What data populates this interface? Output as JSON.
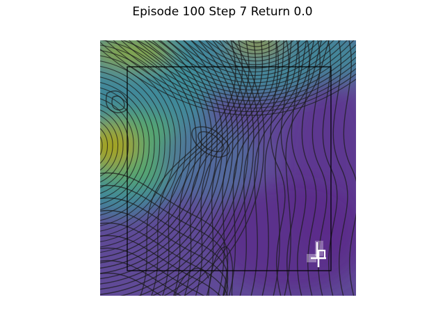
{
  "title": "Episode 100 Step 7 Return 0.0",
  "colors": {
    "background": "#ffffff",
    "colormap": [
      "#5b2a8a",
      "#5f4a97",
      "#4f6f9e",
      "#3f8f9a",
      "#2f9e87",
      "#55a86a",
      "#8aa642",
      "#a8a21d"
    ],
    "contour_line": "#1a1a1a",
    "frame_line": "#000000",
    "agent_marker": "#ffffff"
  },
  "scene": {
    "field": "potential-heatmap",
    "contours": "dense-contour-lines",
    "boundary": "rectangle",
    "agent": "cross-marker",
    "goal": "square-marker"
  }
}
